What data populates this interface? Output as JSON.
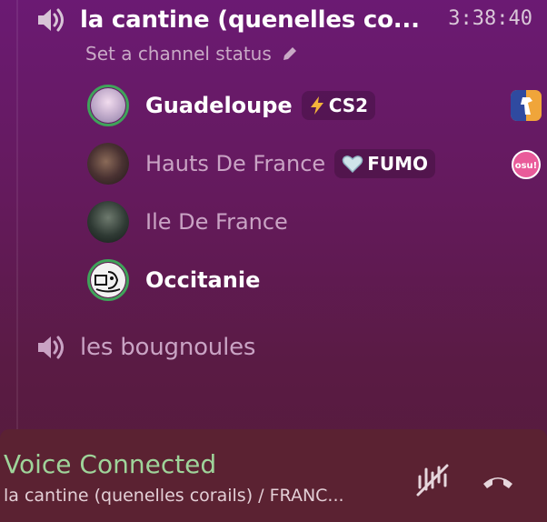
{
  "channels": {
    "active": {
      "name": "la cantine (quenelles co...",
      "timer": "3:38:40",
      "status_label": "Set a channel status"
    },
    "other": {
      "name": "les bougnoules"
    }
  },
  "members": [
    {
      "name": "Guadeloupe",
      "badge": "CS2",
      "speaking": true,
      "activity": "counter-strike-icon"
    },
    {
      "name": "Hauts De France",
      "badge": "FUMO",
      "speaking": false,
      "activity": "osu-icon",
      "activity_text": "osu!"
    },
    {
      "name": "Ile De France"
    },
    {
      "name": "Occitanie",
      "speaking": true
    }
  ],
  "voice": {
    "title": "Voice Connected",
    "subtitle": "la cantine (quenelles corails) / FRANC...",
    "controls": [
      "noise-suppression-icon",
      "disconnect-icon"
    ]
  },
  "colors": {
    "connected": "#9fd49a",
    "speaking_ring": "#3fa35a"
  }
}
